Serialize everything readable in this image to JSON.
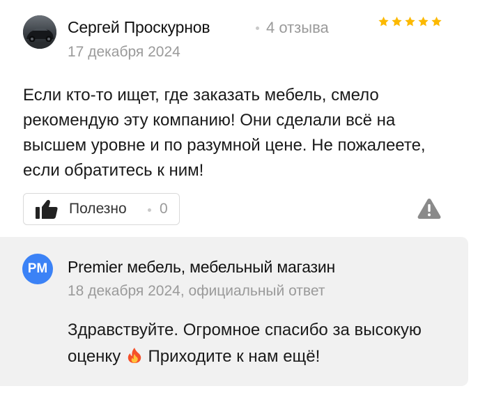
{
  "review": {
    "author": {
      "name": "Сергей Проскурнов",
      "reviews_count": "4 отзыва",
      "avatar_icon": "car-photo-avatar"
    },
    "date": "17 декабря 2024",
    "rating": 5,
    "rating_color": "#fcb900",
    "text": "Если кто-то ищет, где заказать мебель, смело рекомендую эту компанию! Они сделали всё на высшем уровне и по разумной цене. Не пожалеете, если обратитесь к ним!",
    "useful": {
      "label": "Полезно",
      "count": "0",
      "icon": "thumbs-up-icon"
    },
    "report_icon": "warning-triangle-icon"
  },
  "reply": {
    "org_initials": "PM",
    "org_avatar_color": "#3b82f6",
    "org_name": "Premier мебель, мебельный магазин",
    "meta": "18 декабря 2024, официальный ответ",
    "text_part1": "Здравствуйте. Огромное спасибо за высокую оценку",
    "emoji": "fire-emoji",
    "text_part2": "Приходите к нам ещё!"
  }
}
